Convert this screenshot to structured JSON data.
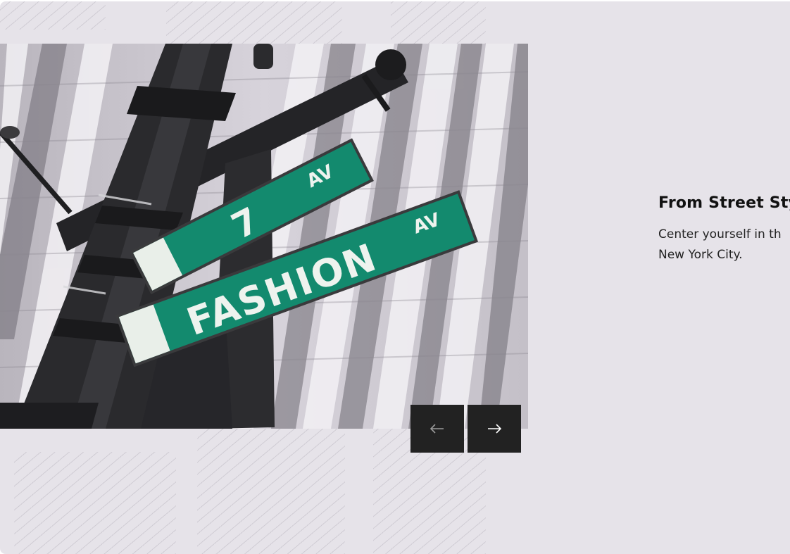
{
  "slide": {
    "image_alt": "Street signs reading 7 AV and FASHION AV",
    "sign_top": {
      "number": "7",
      "suffix": "AV"
    },
    "sign_bottom": {
      "name": "FASHION",
      "suffix": "AV"
    },
    "title": "From Street Sty",
    "description": "Center yourself in th New York City."
  },
  "controls": {
    "prev_icon": "arrow-left-icon",
    "next_icon": "arrow-right-icon"
  },
  "colors": {
    "background": "#e6e3e9",
    "button": "#222222",
    "sign_green": "#138a6e"
  }
}
